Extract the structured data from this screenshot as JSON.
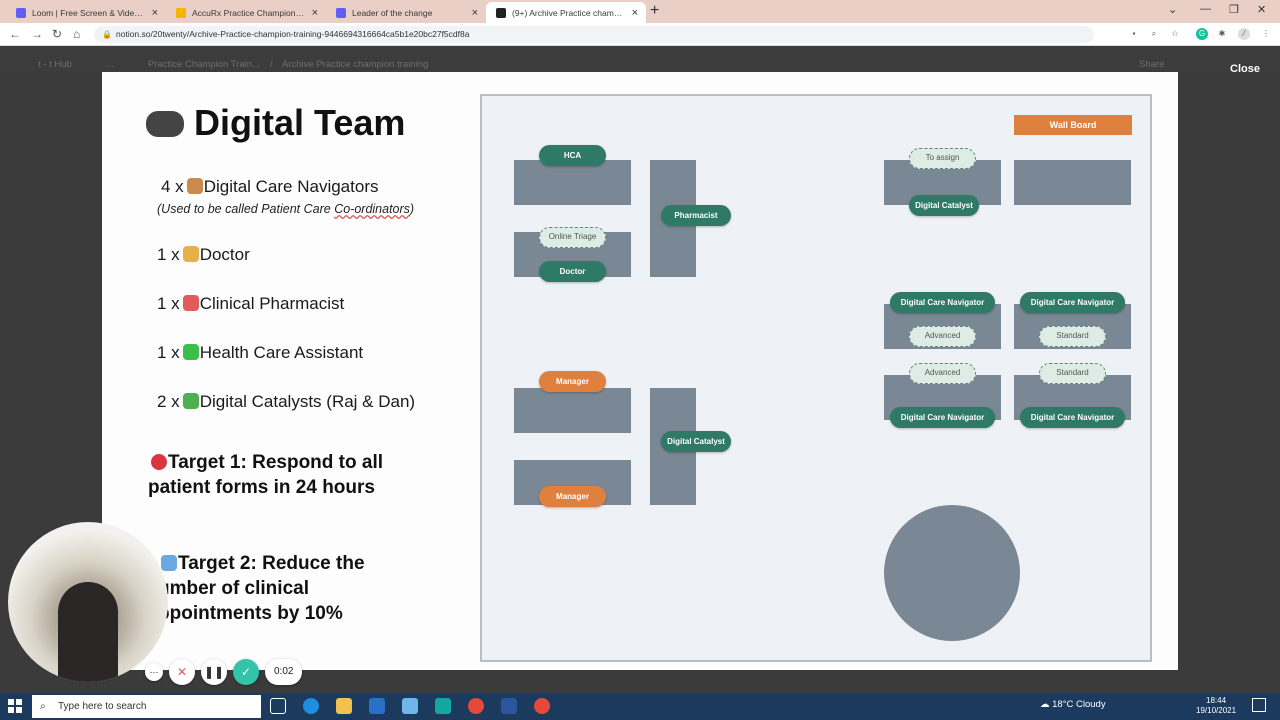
{
  "browser": {
    "tabs": [
      {
        "title": "Loom | Free Screen & Video Recording",
        "favicon_color": "#625df5",
        "active": false
      },
      {
        "title": "AccuRx Practice Champion Training",
        "favicon_color": "#f4b400",
        "active": false
      },
      {
        "title": "Leader of the change",
        "favicon_color": "#625df5",
        "active": false
      },
      {
        "title": "(9+) Archive Practice champion training",
        "favicon_color": "#222222",
        "active": true
      }
    ],
    "new_tab": "+",
    "url": "notion.so/20twenty/Archive-Practice-champion-training-9446694316664ca5b1e20bc27f5cdf8a"
  },
  "notion": {
    "breadcrumb": [
      "t - t Hub",
      "...",
      "Practice Champion Train...",
      "/",
      "Archive Practice champion training"
    ],
    "share": "Share",
    "close_label": "Close"
  },
  "slide": {
    "title": "Digital Team",
    "team": [
      {
        "count": "4 x",
        "role": "Digital Care Navigators",
        "emoji_color": "#c98a4b"
      },
      {
        "count": "1 x",
        "role": "Doctor",
        "emoji_color": "#e8b04a"
      },
      {
        "count": "1 x",
        "role": "Clinical Pharmacist",
        "emoji_color": "#e35a5a"
      },
      {
        "count": "1 x",
        "role": "Health Care Assistant",
        "emoji_color": "#3bbf4a"
      },
      {
        "count": "2 x",
        "role": "Digital Catalysts (Raj & Dan)",
        "emoji_color": "#4caf50"
      }
    ],
    "note_prefix": "(Used to be called Patient Care ",
    "note_underlined": "Co-ordinators",
    "note_suffix": ")",
    "target1": "Target 1: Respond to all patient forms in 24 hours",
    "target2": "Target 2: Reduce the umber of clinical ppointments by 10%"
  },
  "floor_plan": {
    "wall_board": "Wall Board",
    "labels": {
      "hca": "HCA",
      "online_triage": "Online Triage",
      "doctor": "Doctor",
      "pharmacist": "Pharmacist",
      "to_assign": "To assign",
      "digital_catalyst": "Digital Catalyst",
      "dcn": "Digital Care Navigator",
      "advanced": "Advanced",
      "standard": "Standard",
      "manager": "Manager"
    },
    "colors": {
      "desk": "#7a8794",
      "green": "#2e7a66",
      "orange": "#e0803f"
    }
  },
  "loom": {
    "timer": "0:02"
  },
  "taskbar": {
    "search_placeholder": "Type here to search",
    "weather": "18°C  Cloudy",
    "time": "18:44",
    "date": "19/10/2021"
  }
}
